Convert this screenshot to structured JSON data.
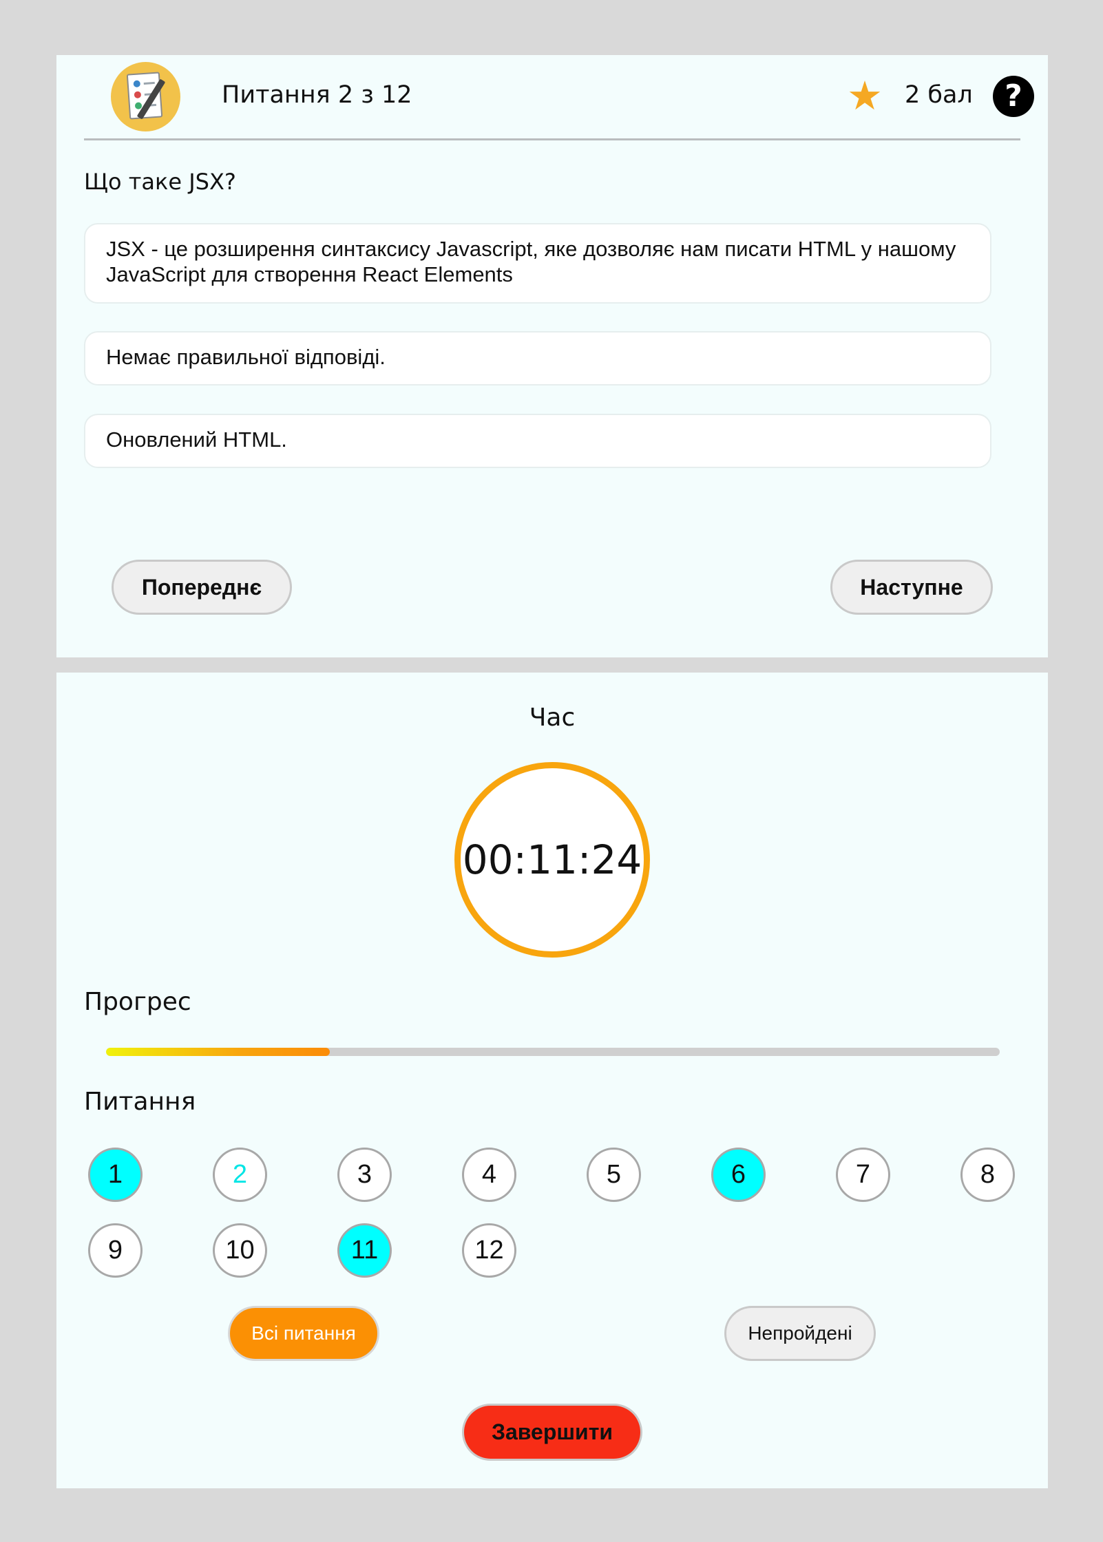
{
  "header": {
    "logo_icon": "quiz-checklist-icon",
    "question_counter": "Питання 2 з 12",
    "score_icon": "star-icon",
    "score": "2 бал",
    "help_icon": "question-mark-icon",
    "help_label": "?"
  },
  "question": {
    "text": "Що таке JSX?",
    "answers": [
      "JSX - це розширення синтаксису Javascript, яке дозволяє нам писати HTML у нашому JavaScript для створення React Elements",
      "Немає правильної відповіді.",
      "Оновлений HTML."
    ]
  },
  "navigation": {
    "prev_label": "Попереднє",
    "next_label": "Наступне"
  },
  "timer": {
    "title": "Час",
    "value": "00:11:24",
    "ring_color": "#f8a50e"
  },
  "progress": {
    "title": "Прогрес",
    "fraction": 0.25
  },
  "questions_panel": {
    "title": "Питання",
    "items": [
      {
        "label": "1",
        "state": "answered"
      },
      {
        "label": "2",
        "state": "current"
      },
      {
        "label": "3",
        "state": "none"
      },
      {
        "label": "4",
        "state": "none"
      },
      {
        "label": "5",
        "state": "none"
      },
      {
        "label": "6",
        "state": "answered"
      },
      {
        "label": "7",
        "state": "none"
      },
      {
        "label": "8",
        "state": "none"
      },
      {
        "label": "9",
        "state": "none"
      },
      {
        "label": "10",
        "state": "none"
      },
      {
        "label": "11",
        "state": "answered"
      },
      {
        "label": "12",
        "state": "none"
      }
    ],
    "all_label": "Всі питання",
    "unanswered_label": "Непройдені"
  },
  "finish_label": "Завершити",
  "colors": {
    "answered": "#00ffff",
    "accent_orange": "#fb9004",
    "finish_red": "#f72d16",
    "panel_bg": "#f3fdfd"
  }
}
